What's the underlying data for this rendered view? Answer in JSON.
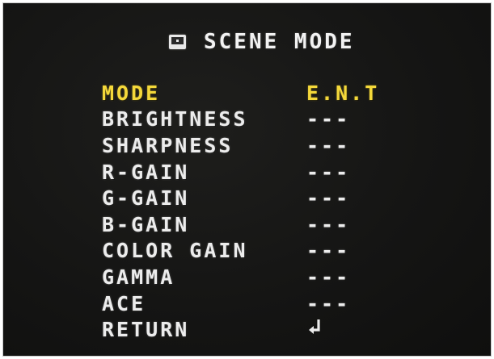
{
  "title": {
    "icon": "scene-mode-icon",
    "text": "SCENE MODE"
  },
  "menu": {
    "items": [
      {
        "label": "MODE",
        "value": "E.N.T",
        "selected": true
      },
      {
        "label": "BRIGHTNESS",
        "value": "---",
        "selected": false
      },
      {
        "label": "SHARPNESS",
        "value": "---",
        "selected": false
      },
      {
        "label": "R-GAIN",
        "value": "---",
        "selected": false
      },
      {
        "label": "G-GAIN",
        "value": "---",
        "selected": false
      },
      {
        "label": "B-GAIN",
        "value": "---",
        "selected": false
      },
      {
        "label": "COLOR GAIN",
        "value": "---",
        "selected": false
      },
      {
        "label": "GAMMA",
        "value": "---",
        "selected": false
      },
      {
        "label": "ACE",
        "value": "---",
        "selected": false
      },
      {
        "label": "RETURN",
        "value": "",
        "icon": "return-arrow-icon",
        "selected": false
      }
    ]
  },
  "colors": {
    "highlight": "#f4d83a",
    "text": "#ececec",
    "background": "#151514"
  }
}
